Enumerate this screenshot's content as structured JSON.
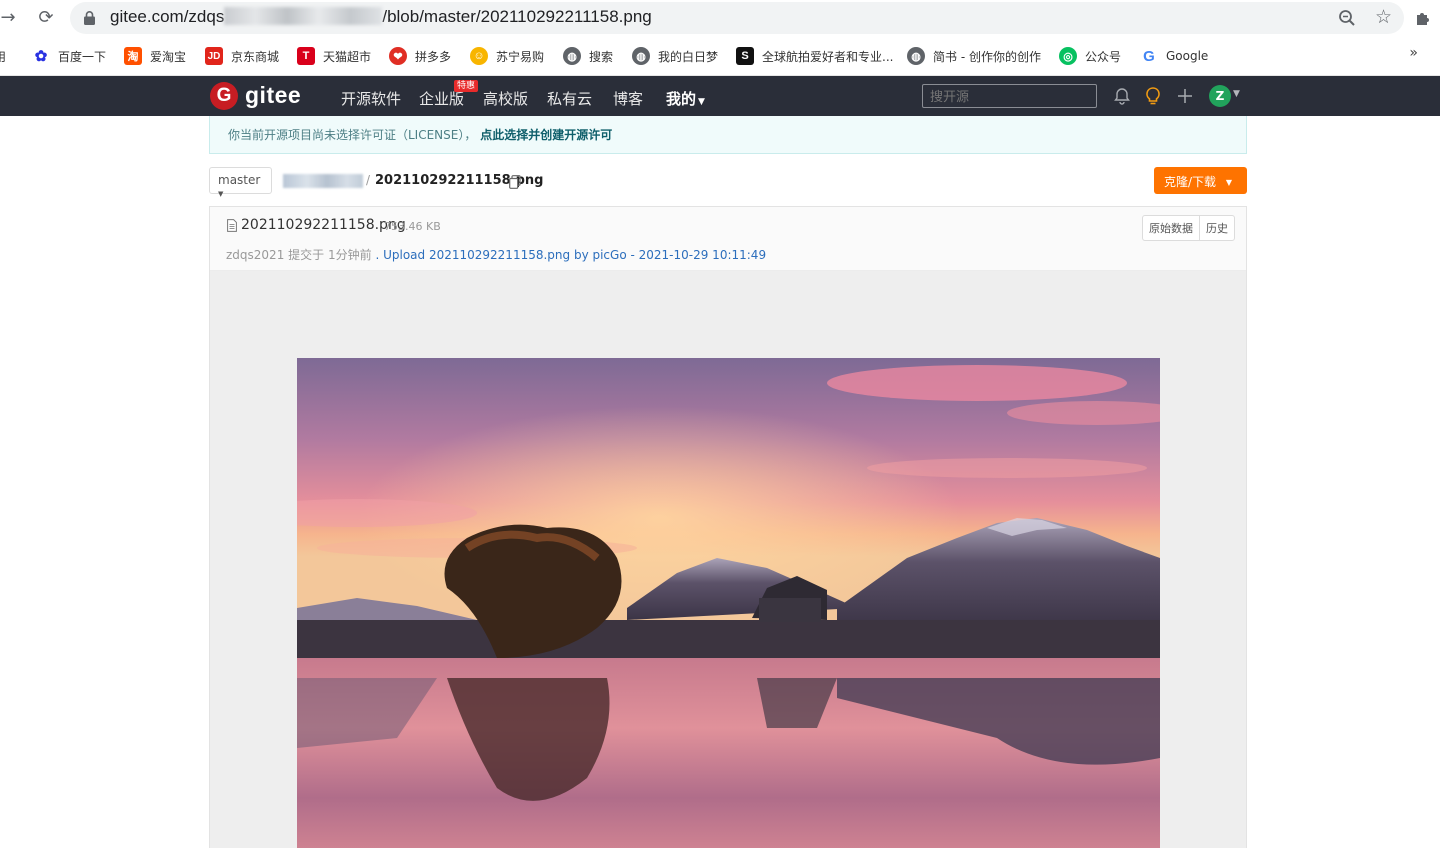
{
  "browser": {
    "url_prefix": "gitee.com/zdqs",
    "url_suffix": "/blob/master/202110292211158.png"
  },
  "bookmarks": [
    {
      "label": "用",
      "icon": "apps-icon",
      "color": "#888888"
    },
    {
      "label": "百度一下",
      "icon": "baidu-paw-icon",
      "color": "#2932e1"
    },
    {
      "label": "爱淘宝",
      "icon": "taobao-icon",
      "color": "#ff5000"
    },
    {
      "label": "京东商城",
      "icon": "jd-icon",
      "color": "#e1251b"
    },
    {
      "label": "天猫超市",
      "icon": "tmall-icon",
      "color": "#d9001b"
    },
    {
      "label": "拼多多",
      "icon": "pinduoduo-icon",
      "color": "#e02e24"
    },
    {
      "label": "苏宁易购",
      "icon": "suning-lion-icon",
      "color": "#f8b500"
    },
    {
      "label": "搜索",
      "icon": "globe-icon",
      "color": "#5f6368"
    },
    {
      "label": "我的白日梦",
      "icon": "globe-icon",
      "color": "#5f6368"
    },
    {
      "label": "全球航拍爱好者和专业...",
      "icon": "skypixel-icon",
      "color": "#111111"
    },
    {
      "label": "简书 - 创作你的创作",
      "icon": "globe-icon",
      "color": "#5f6368"
    },
    {
      "label": "公众号",
      "icon": "wechat-official-icon",
      "color": "#07c160"
    },
    {
      "label": "Google",
      "icon": "google-icon",
      "color": "#4285f4"
    }
  ],
  "header": {
    "logo_text": "gitee",
    "nav": [
      "开源软件",
      "企业版",
      "高校版",
      "私有云",
      "博客",
      "我的"
    ],
    "enterprise_badge": "特惠",
    "search_placeholder": "搜开源",
    "avatar_letter": "Z"
  },
  "license_notice": {
    "text": "你当前开源项目尚未选择许可证（LICENSE），",
    "link": "点此选择并创建开源许可"
  },
  "repo_bar": {
    "branch": "master",
    "path_separator": "/",
    "file_name": "202110292211158.png",
    "clone_button": "克隆/下载"
  },
  "file": {
    "name": "202110292211158.png",
    "size": "753.46 KB",
    "author": "zdqs2021",
    "commit_prefix": "提交于",
    "commit_time_ago": "1分钟前",
    "commit_message": ". Upload 202110292211158.png by picGo - 2021-10-29 10:11:49",
    "raw_button": "原始数据",
    "history_button": "历史"
  },
  "colors": {
    "header_bg": "#2a2e39",
    "clone_orange": "#fe7300",
    "gitee_red": "#c71d23"
  }
}
